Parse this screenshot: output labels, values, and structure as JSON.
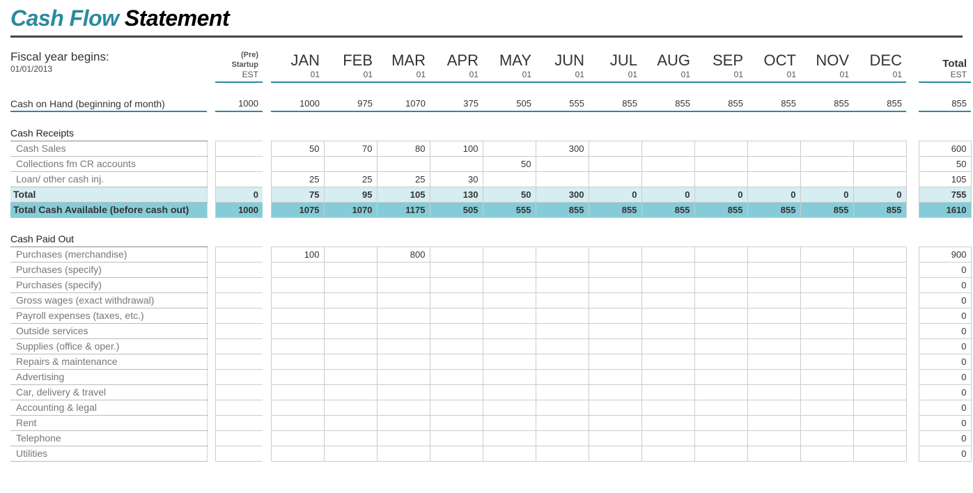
{
  "title_accent": "Cash Flow",
  "title_rest": " Statement",
  "fiscal_label": "Fiscal year begins:",
  "fiscal_date": "01/01/2013",
  "header": {
    "pre_line1": "(Pre)",
    "pre_line2": "Startup",
    "pre_sub": "EST",
    "months": [
      "JAN",
      "FEB",
      "MAR",
      "APR",
      "MAY",
      "JUN",
      "JUL",
      "AUG",
      "SEP",
      "OCT",
      "NOV",
      "DEC"
    ],
    "month_sub": "01",
    "total": "Total",
    "total_sub": "EST"
  },
  "rows": {
    "cash_on_hand": {
      "label": "Cash on Hand (beginning of month)",
      "pre": "1000",
      "m": [
        "1000",
        "975",
        "1070",
        "375",
        "505",
        "555",
        "855",
        "855",
        "855",
        "855",
        "855",
        "855"
      ],
      "total": "855"
    },
    "receipts_header": "Cash Receipts",
    "cash_sales": {
      "label": "Cash Sales",
      "pre": "",
      "m": [
        "50",
        "70",
        "80",
        "100",
        "",
        "300",
        "",
        "",
        "",
        "",
        "",
        ""
      ],
      "total": "600"
    },
    "collections": {
      "label": "Collections fm CR accounts",
      "pre": "",
      "m": [
        "",
        "",
        "",
        "",
        "50",
        "",
        "",
        "",
        "",
        "",
        "",
        ""
      ],
      "total": "50"
    },
    "loan_other": {
      "label": "Loan/ other cash inj.",
      "pre": "",
      "m": [
        "25",
        "25",
        "25",
        "30",
        "",
        "",
        "",
        "",
        "",
        "",
        "",
        ""
      ],
      "total": "105"
    },
    "receipts_total": {
      "label": "Total",
      "pre": "0",
      "m": [
        "75",
        "95",
        "105",
        "130",
        "50",
        "300",
        "0",
        "0",
        "0",
        "0",
        "0",
        "0"
      ],
      "total": "755"
    },
    "total_avail": {
      "label": "Total Cash Available (before cash out)",
      "pre": "1000",
      "m": [
        "1075",
        "1070",
        "1175",
        "505",
        "555",
        "855",
        "855",
        "855",
        "855",
        "855",
        "855",
        "855"
      ],
      "total": "1610"
    },
    "paid_header": "Cash Paid Out",
    "paid": [
      {
        "label": "Purchases (merchandise)",
        "pre": "",
        "m": [
          "100",
          "",
          "800",
          "",
          "",
          "",
          "",
          "",
          "",
          "",
          "",
          ""
        ],
        "total": "900"
      },
      {
        "label": "Purchases (specify)",
        "pre": "",
        "m": [
          "",
          "",
          "",
          "",
          "",
          "",
          "",
          "",
          "",
          "",
          "",
          ""
        ],
        "total": "0"
      },
      {
        "label": "Purchases (specify)",
        "pre": "",
        "m": [
          "",
          "",
          "",
          "",
          "",
          "",
          "",
          "",
          "",
          "",
          "",
          ""
        ],
        "total": "0"
      },
      {
        "label": "Gross wages (exact withdrawal)",
        "pre": "",
        "m": [
          "",
          "",
          "",
          "",
          "",
          "",
          "",
          "",
          "",
          "",
          "",
          ""
        ],
        "total": "0"
      },
      {
        "label": "Payroll expenses (taxes, etc.)",
        "pre": "",
        "m": [
          "",
          "",
          "",
          "",
          "",
          "",
          "",
          "",
          "",
          "",
          "",
          ""
        ],
        "total": "0"
      },
      {
        "label": "Outside services",
        "pre": "",
        "m": [
          "",
          "",
          "",
          "",
          "",
          "",
          "",
          "",
          "",
          "",
          "",
          ""
        ],
        "total": "0"
      },
      {
        "label": "Supplies (office & oper.)",
        "pre": "",
        "m": [
          "",
          "",
          "",
          "",
          "",
          "",
          "",
          "",
          "",
          "",
          "",
          ""
        ],
        "total": "0"
      },
      {
        "label": "Repairs & maintenance",
        "pre": "",
        "m": [
          "",
          "",
          "",
          "",
          "",
          "",
          "",
          "",
          "",
          "",
          "",
          ""
        ],
        "total": "0"
      },
      {
        "label": "Advertising",
        "pre": "",
        "m": [
          "",
          "",
          "",
          "",
          "",
          "",
          "",
          "",
          "",
          "",
          "",
          ""
        ],
        "total": "0"
      },
      {
        "label": "Car, delivery & travel",
        "pre": "",
        "m": [
          "",
          "",
          "",
          "",
          "",
          "",
          "",
          "",
          "",
          "",
          "",
          ""
        ],
        "total": "0"
      },
      {
        "label": "Accounting & legal",
        "pre": "",
        "m": [
          "",
          "",
          "",
          "",
          "",
          "",
          "",
          "",
          "",
          "",
          "",
          ""
        ],
        "total": "0"
      },
      {
        "label": "Rent",
        "pre": "",
        "m": [
          "",
          "",
          "",
          "",
          "",
          "",
          "",
          "",
          "",
          "",
          "",
          ""
        ],
        "total": "0"
      },
      {
        "label": "Telephone",
        "pre": "",
        "m": [
          "",
          "",
          "",
          "",
          "",
          "",
          "",
          "",
          "",
          "",
          "",
          ""
        ],
        "total": "0"
      },
      {
        "label": "Utilities",
        "pre": "",
        "m": [
          "",
          "",
          "",
          "",
          "",
          "",
          "",
          "",
          "",
          "",
          "",
          ""
        ],
        "total": "0"
      }
    ]
  }
}
